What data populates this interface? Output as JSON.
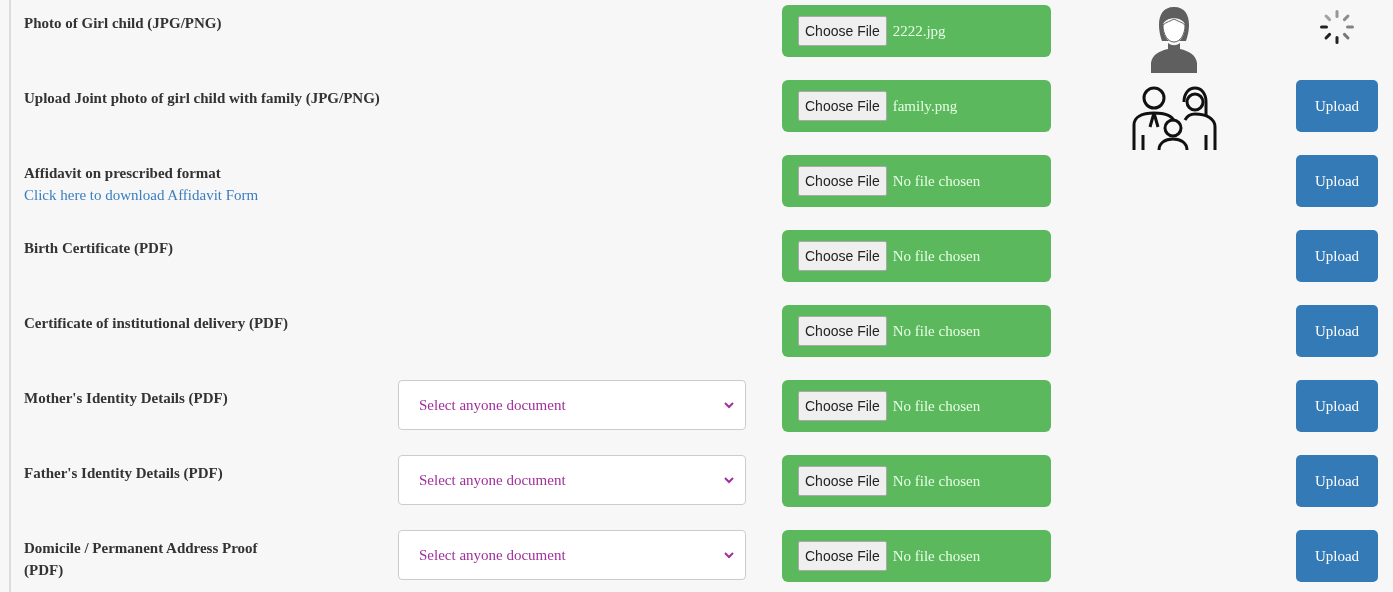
{
  "rows": [
    {
      "label": "Photo of Girl child (JPG/PNG)",
      "button": "Choose File",
      "file_name": "2222.jpg",
      "preview": {
        "kind": "woman"
      },
      "action": {
        "kind": "loading"
      }
    },
    {
      "label": "Upload Joint photo of girl child with family (JPG/PNG)",
      "button": "Choose File",
      "file_name": "family.png",
      "preview": {
        "kind": "family"
      },
      "action": {
        "kind": "button",
        "label": "Upload"
      }
    },
    {
      "label": "Affidavit on prescribed format",
      "link": "Click here to download Affidavit Form",
      "button": "Choose File",
      "file_name": "No file chosen",
      "action": {
        "kind": "button",
        "label": "Upload"
      }
    },
    {
      "label": "Birth Certificate (PDF)",
      "button": "Choose File",
      "file_name": "No file chosen",
      "action": {
        "kind": "button",
        "label": "Upload"
      }
    },
    {
      "label": "Certificate of institutional delivery (PDF)",
      "button": "Choose File",
      "file_name": "No file chosen",
      "action": {
        "kind": "button",
        "label": "Upload"
      }
    },
    {
      "label": "Mother's Identity Details (PDF)",
      "select": {
        "placeholder": "Select anyone document"
      },
      "button": "Choose File",
      "file_name": "No file chosen",
      "action": {
        "kind": "button",
        "label": "Upload"
      }
    },
    {
      "label": "Father's Identity Details (PDF)",
      "select": {
        "placeholder": "Select anyone document"
      },
      "button": "Choose File",
      "file_name": "No file chosen",
      "action": {
        "kind": "button",
        "label": "Upload"
      }
    },
    {
      "label": "Domicile / Permanent Address Proof (PDF)",
      "select": {
        "placeholder": "Select anyone document"
      },
      "button": "Choose File",
      "file_name": "No file chosen",
      "action": {
        "kind": "button",
        "label": "Upload"
      }
    }
  ]
}
